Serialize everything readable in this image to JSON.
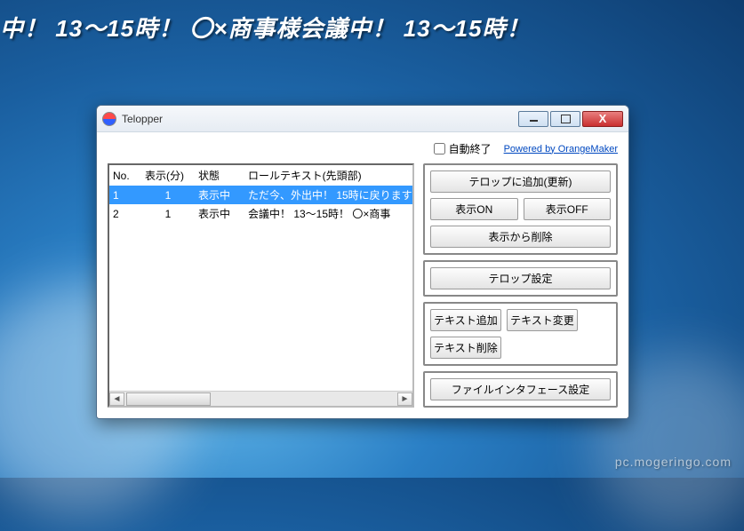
{
  "ticker_text": "中！ 13～15時！ 〇×商事様会議中！ 13～15時！",
  "window": {
    "title": "Telopper",
    "auto_end_label": "自動終了",
    "powered_link": "Powered by OrangeMaker"
  },
  "table": {
    "headers": {
      "no": "No.",
      "disp_min": "表示(分)",
      "state": "状態",
      "roll_text": "ロールテキスト(先頭部)"
    },
    "rows": [
      {
        "no": "1",
        "disp_min": "1",
        "state": "表示中",
        "roll_text": "ただ今、外出中！ 15時に戻ります"
      },
      {
        "no": "2",
        "disp_min": "1",
        "state": "表示中",
        "roll_text": "会議中！ 13～15時！ 〇×商事"
      }
    ]
  },
  "buttons": {
    "add_telop": "テロップに追加(更新)",
    "show_on": "表示ON",
    "show_off": "表示OFF",
    "remove_display": "表示から削除",
    "telop_settings": "テロップ設定",
    "text_add": "テキスト追加",
    "text_change": "テキスト変更",
    "text_delete": "テキスト削除",
    "file_if_settings": "ファイルインタフェース設定"
  },
  "watermark": "pc.mogeringo.com"
}
